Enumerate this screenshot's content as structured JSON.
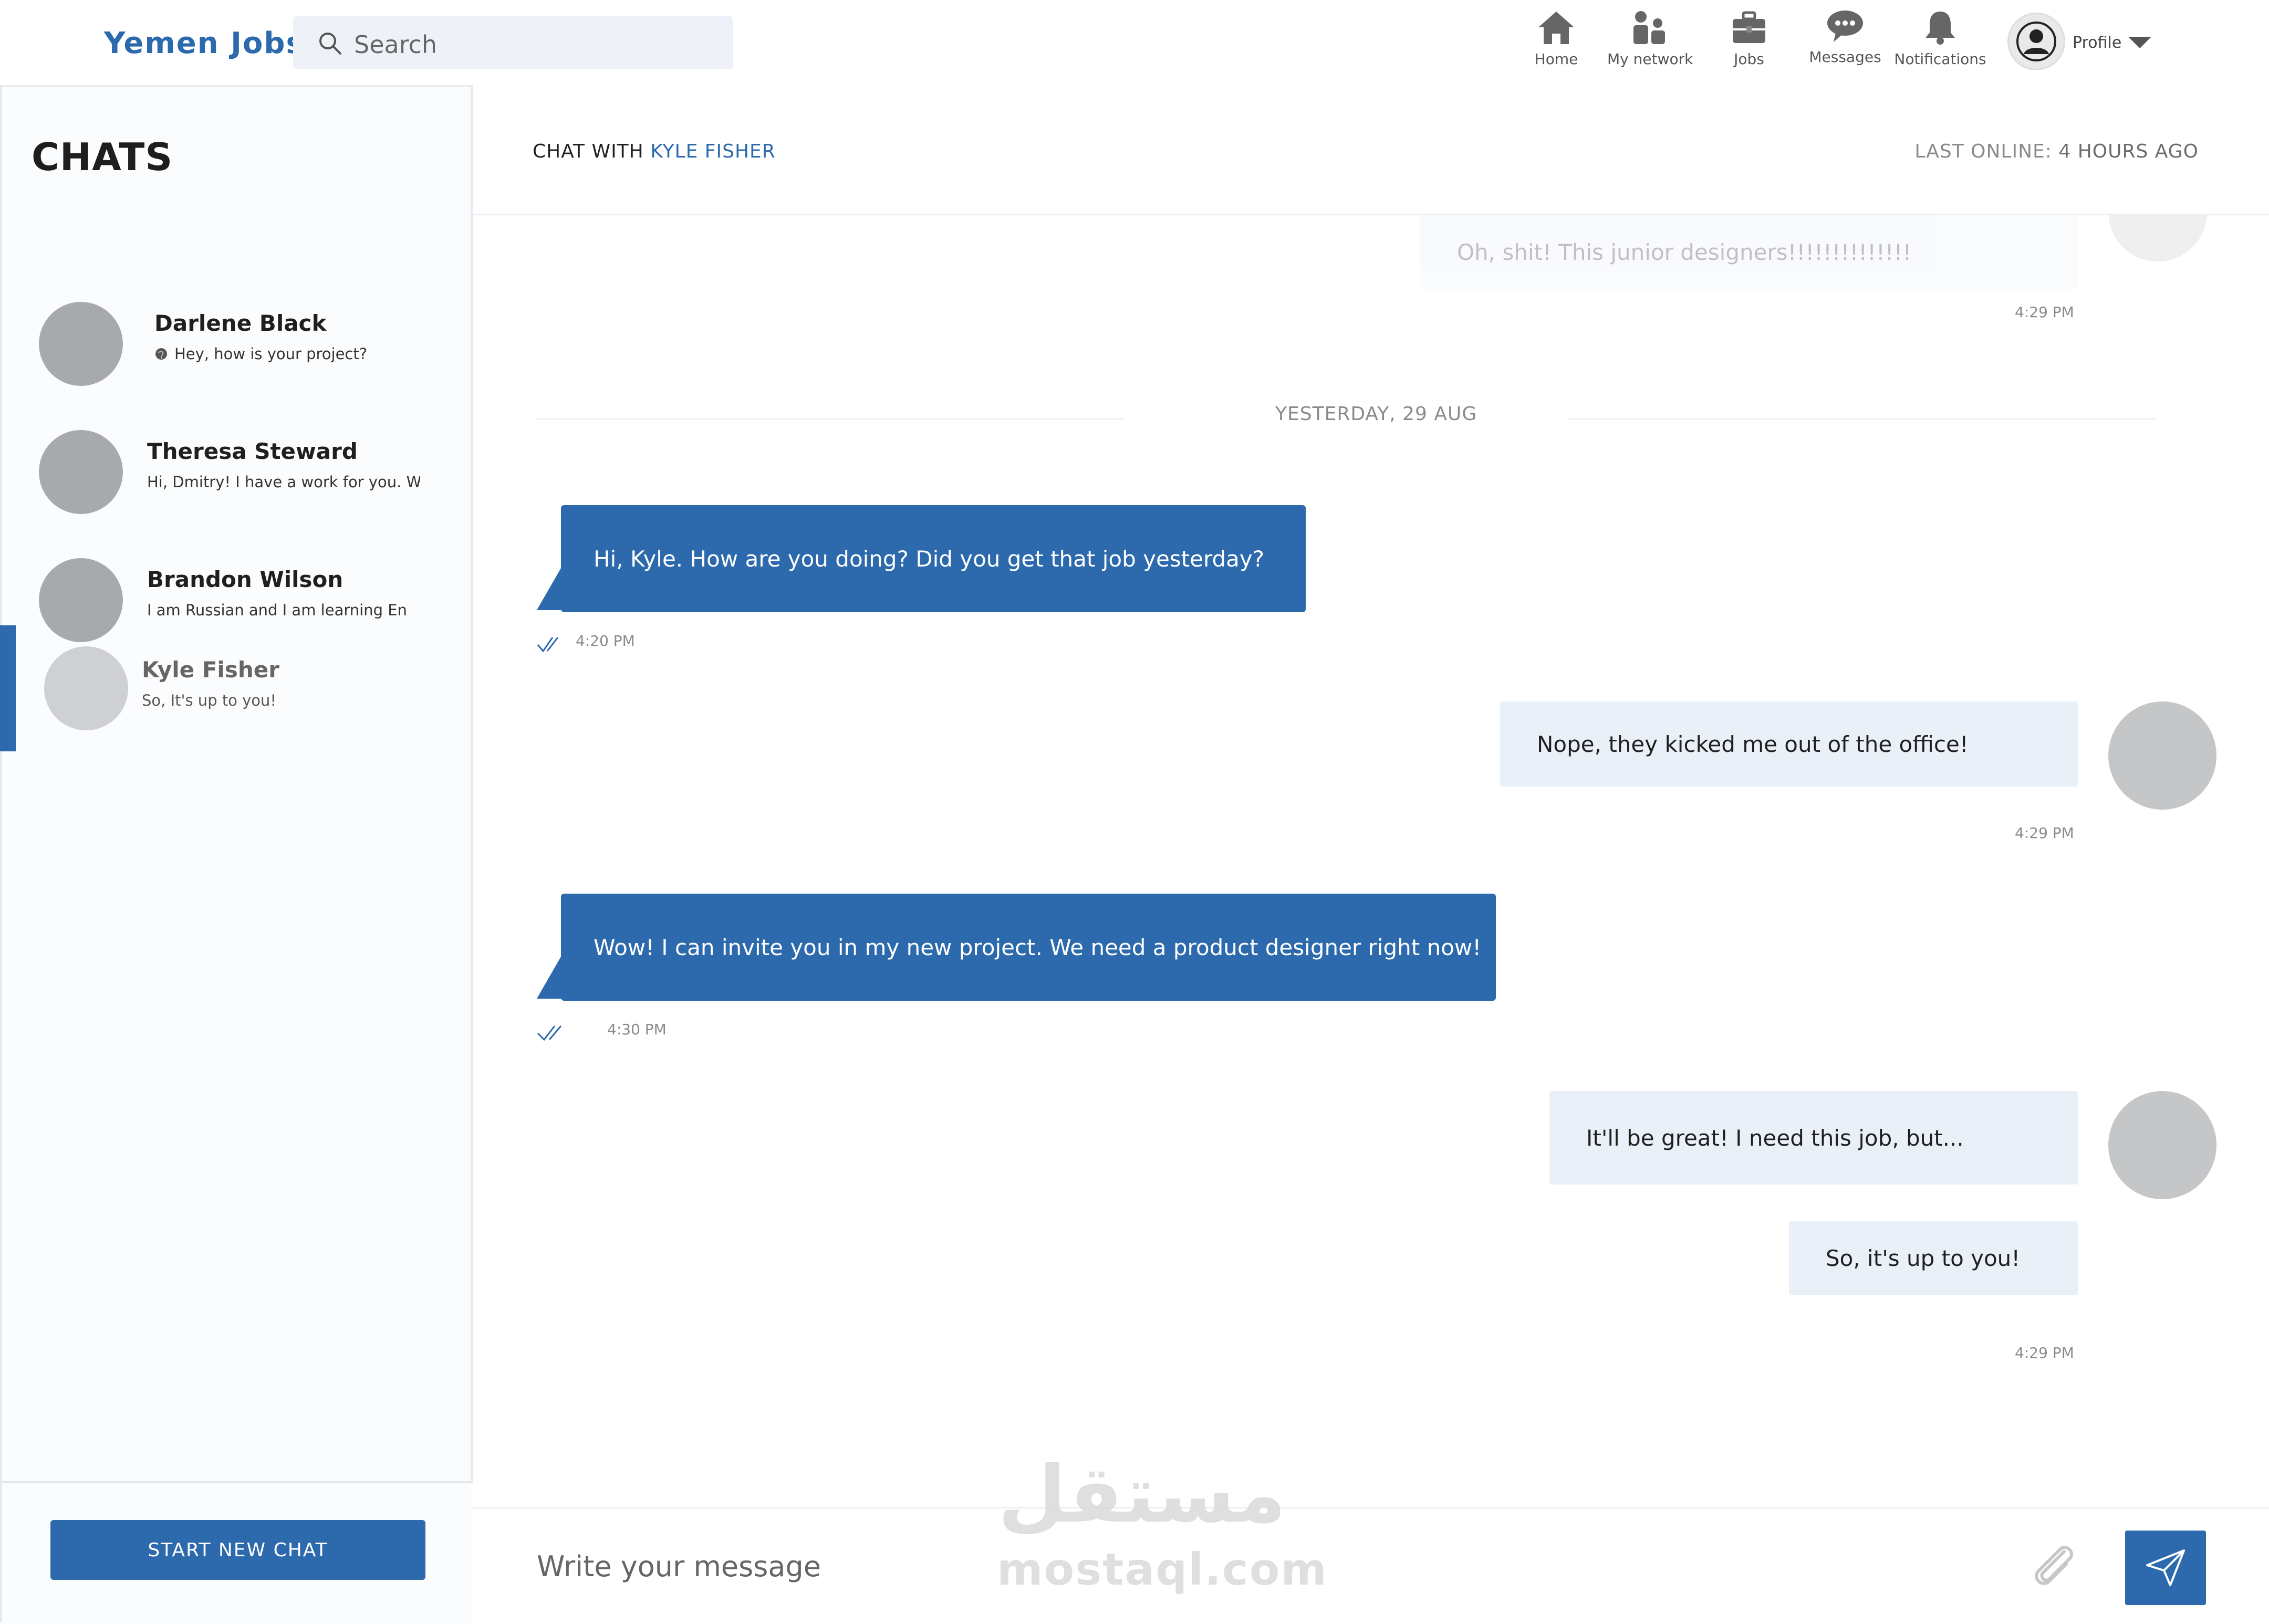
{
  "app": {
    "logo": "Yemen Jobs"
  },
  "search": {
    "placeholder": "Search"
  },
  "nav": {
    "home": "Home",
    "network": "My network",
    "jobs": "Jobs",
    "messages": "Messages",
    "notifications": "Notifications",
    "profile": "Profile"
  },
  "sidebar": {
    "title": "CHATS",
    "chats": [
      {
        "name": "Darlene Black",
        "preview": "Hey, how is your project?"
      },
      {
        "name": "Theresa Steward",
        "preview": "Hi, Dmitry! I have a work for you. W"
      },
      {
        "name": "Brandon Wilson",
        "preview": "I am Russian and I am learning En"
      },
      {
        "name": "Kyle Fisher",
        "preview": "So, It's up to you!"
      }
    ],
    "start_button": "START NEW CHAT"
  },
  "chat": {
    "with_label": "CHAT WITH",
    "with_name": "KYLE FISHER",
    "last_online_label": "LAST ONLINE:",
    "last_online_value": "4 HOURS AGO",
    "date_separator": "YESTERDAY, 29 AUG",
    "messages": [
      {
        "text": "Oh, shit! This junior designers!!!!!!!!!!!!!!",
        "time": "4:29 PM"
      },
      {
        "text": "Hi, Kyle. How are you doing? Did you get that job yesterday?",
        "time": "4:20 PM"
      },
      {
        "text": "Nope, they kicked me out of the office!",
        "time": "4:29 PM"
      },
      {
        "text": "Wow! I can invite you in my new project. We need a product designer right now!",
        "time": "4:30 PM"
      },
      {
        "text": "It'll be great! I need this job, but...",
        "time": ""
      },
      {
        "text": "So, it's up to you!",
        "time": "4:29 PM"
      }
    ]
  },
  "composer": {
    "placeholder": "Write your message"
  },
  "watermark": {
    "arabic": "مستقل",
    "latin": "mostaql.com"
  },
  "colors": {
    "accent": "#2c6aad",
    "incoming_bubble": "#eaf0f8",
    "avatar": "#a7a9ab"
  }
}
